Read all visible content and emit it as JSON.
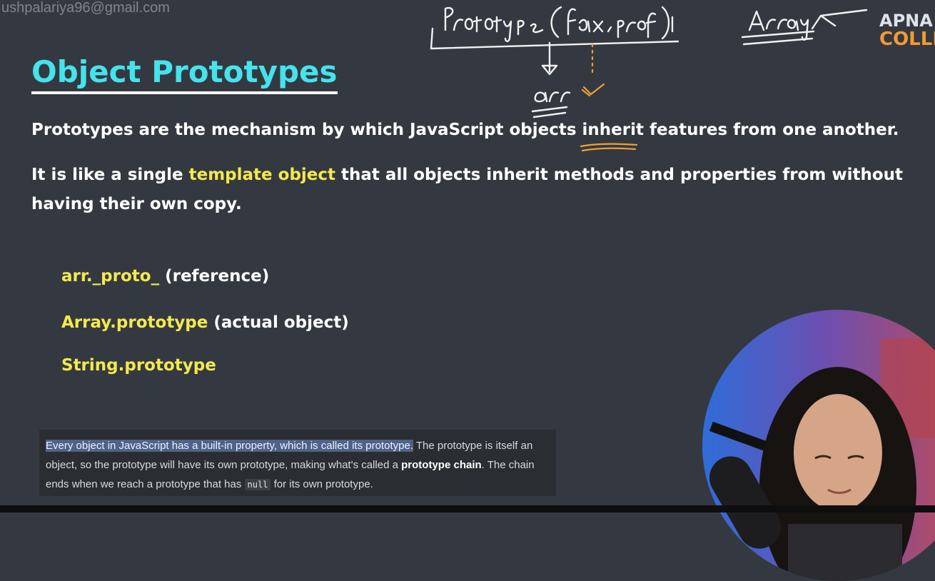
{
  "watermark": "ushpalariya96@gmail.com",
  "slide": {
    "title": "Object Prototypes",
    "para1": {
      "before": "Prototypes are the mechanism by which JavaScript objects ",
      "underlined": "inherit",
      "after": " features from one another."
    },
    "para2": {
      "before": "It is like a single ",
      "highlight": "template object",
      "after": " that all objects inherit methods and properties from without having their own copy."
    },
    "items": [
      {
        "keyword": "arr._proto_",
        "note": " (reference)"
      },
      {
        "keyword": "Array.prototype",
        "note": " (actual object)"
      },
      {
        "keyword": "String.prototype",
        "note": ""
      }
    ]
  },
  "caption": {
    "selected": "Every object in JavaScript has a built-in property, which is called its prototype.",
    "rest1": " The prototype is itself an object, so the prototype will have its own prototype, making what's called a ",
    "bold1": "prototype chain",
    "rest2": ". The chain ends when we reach a prototype that has ",
    "code": "null",
    "rest3": " for its own prototype."
  },
  "logo": {
    "line1": "APNA",
    "line2": "COLLEGE"
  },
  "colors": {
    "background": "#343941",
    "title": "#45e3ec",
    "highlight": "#f3ea4c",
    "logo_orange": "#f39a34",
    "selection": "#4d6388"
  }
}
